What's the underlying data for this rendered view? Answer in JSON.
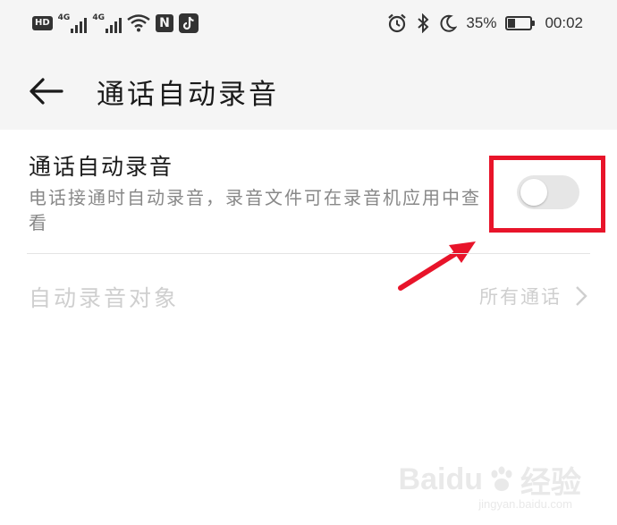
{
  "status_bar": {
    "hd": "HD",
    "net1": "4G",
    "net2": "4G",
    "nfc_glyph": "N",
    "battery_percent": "35%",
    "battery_level": 0.35,
    "time": "00:02",
    "icons": [
      "hd-icon",
      "signal-icon",
      "signal-icon",
      "wifi-icon",
      "nfc-icon",
      "tiktok-icon",
      "alarm-icon",
      "bluetooth-icon",
      "moon-icon",
      "battery-icon"
    ]
  },
  "header": {
    "back_icon": "back-arrow-icon",
    "title": "通话自动录音"
  },
  "auto_record": {
    "title": "通话自动录音",
    "description": "电话接通时自动录音，录音文件可在录音机应用中查看",
    "enabled": false
  },
  "record_target": {
    "label": "自动录音对象",
    "value": "所有通话",
    "chevron_icon": "chevron-right-icon"
  },
  "annotation": {
    "box_color": "#e8142a",
    "arrow_color": "#e8142a"
  },
  "watermark": {
    "brand": "Baidu",
    "suffix": "经验",
    "url": "jingyan.baidu.com"
  }
}
